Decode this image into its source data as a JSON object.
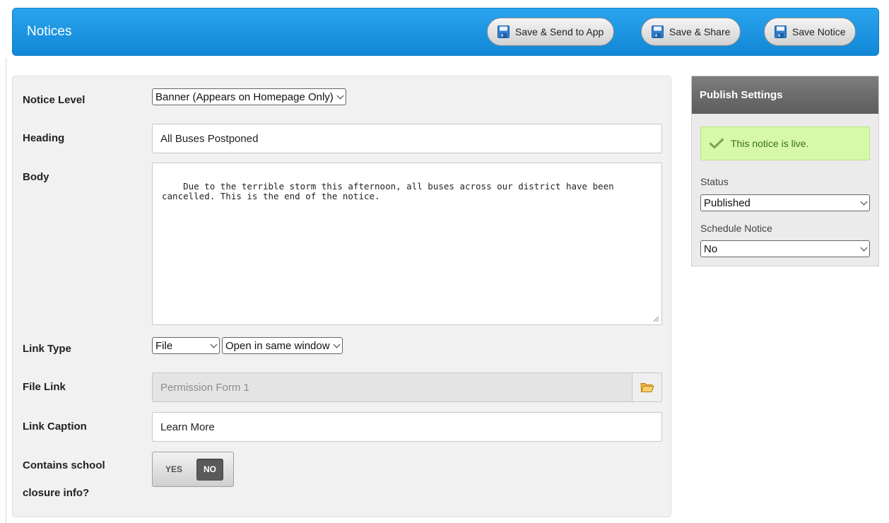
{
  "header": {
    "title": "Notices",
    "buttons": {
      "send_app": "Save & Send to App",
      "share": "Save & Share",
      "save": "Save Notice"
    }
  },
  "form": {
    "notice_level": {
      "label": "Notice Level",
      "value": "Banner (Appears on Homepage Only)"
    },
    "heading": {
      "label": "Heading",
      "value": "All Buses Postponed"
    },
    "body": {
      "label": "Body",
      "value": "Due to the terrible storm this afternoon, all buses across our district have been\ncancelled. This is the end of the notice."
    },
    "link_type": {
      "label": "Link Type",
      "type_value": "File",
      "window_value": "Open in same window"
    },
    "file_link": {
      "label": "File Link",
      "placeholder": "Permission Form 1"
    },
    "link_caption": {
      "label": "Link Caption",
      "value": "Learn More"
    },
    "closure": {
      "label_line1": "Contains school",
      "label_line2": "closure info?",
      "yes": "YES",
      "no": "NO",
      "selected": "NO"
    }
  },
  "publish": {
    "title": "Publish Settings",
    "live_message": "This notice is live.",
    "status_label": "Status",
    "status_value": "Published",
    "schedule_label": "Schedule Notice",
    "schedule_value": "No"
  },
  "colors": {
    "header_blue": "#1a95e0",
    "live_green_bg": "#d5f9a9",
    "toggle_selected": "#5a5a5a"
  },
  "icons": [
    "floppy-disk-icon",
    "folder-open-icon",
    "checkmark-icon",
    "chevron-down-icon"
  ]
}
